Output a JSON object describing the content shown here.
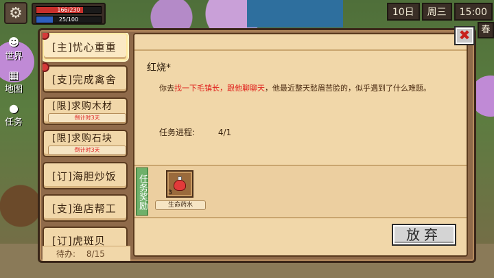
{
  "hud": {
    "hp_text": "166/230",
    "hp_fraction": 0.72,
    "mp_text": "25/100",
    "mp_fraction": 0.25,
    "day": "10日",
    "weekday": "周三",
    "time": "15:00",
    "season": "春"
  },
  "side_nav": [
    {
      "label": "世界",
      "icon": "people-icon"
    },
    {
      "label": "地图",
      "icon": "map-icon"
    },
    {
      "label": "任务",
      "icon": "quest-pin-icon"
    }
  ],
  "quests": [
    {
      "name": "[主]忧心重重",
      "active": true,
      "dot": true,
      "timer": ""
    },
    {
      "name": "[支]完成禽舍",
      "active": false,
      "dot": true,
      "timer": ""
    },
    {
      "name": "[限]求购木材",
      "active": false,
      "dot": false,
      "timer": "倒计时3天"
    },
    {
      "name": "[限]求购石块",
      "active": false,
      "dot": false,
      "timer": "倒计时3天"
    },
    {
      "name": "[订]海胆炒饭",
      "active": false,
      "dot": false,
      "timer": ""
    },
    {
      "name": "[支]渔店帮工",
      "active": false,
      "dot": false,
      "timer": ""
    },
    {
      "name": "[订]虎斑贝",
      "active": false,
      "dot": false,
      "timer": ""
    }
  ],
  "pending": {
    "label": "待办:",
    "value": "8/15"
  },
  "detail": {
    "title": "红烧*",
    "desc_pre": "你去",
    "desc_hl": "找一下毛镇长，跟他聊聊天",
    "desc_post": "，他最近整天愁眉苦脸的，似乎遇到了什么难题。",
    "progress_label": "任务进程:",
    "progress_value": "4/1",
    "reward_tab": "任务奖励",
    "reward": {
      "name": "生命药水",
      "qty": "3",
      "icon": "health-potion-icon"
    },
    "abandon_label": "放弃"
  },
  "close_label": "✖"
}
